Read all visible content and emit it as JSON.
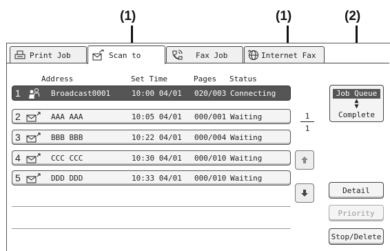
{
  "callouts": [
    "(1)",
    "(1)",
    "(2)"
  ],
  "tabs": [
    {
      "label": "Print Job",
      "icon": "printer-icon"
    },
    {
      "label": "Scan to",
      "icon": "scanner-icon"
    },
    {
      "label": "Fax Job",
      "icon": "phone-icon"
    },
    {
      "label": "Internet Fax",
      "icon": "globe-phone-icon"
    }
  ],
  "columns": {
    "address": "Address",
    "set_time": "Set Time",
    "pages": "Pages",
    "status": "Status"
  },
  "jobs": [
    {
      "num": "1",
      "icon": "broadcast-icon",
      "address": "Broadcast0001",
      "time": "10:00 04/01",
      "pages": "020/003",
      "status": "Connecting",
      "selected": true
    },
    {
      "num": "2",
      "icon": "email-icon",
      "address": "AAA AAA",
      "time": "10:05 04/01",
      "pages": "000/001",
      "status": "Waiting"
    },
    {
      "num": "3",
      "icon": "email-icon",
      "address": "BBB BBB",
      "time": "10:22 04/01",
      "pages": "000/004",
      "status": "Waiting"
    },
    {
      "num": "4",
      "icon": "email-icon",
      "address": "CCC CCC",
      "time": "10:30 04/01",
      "pages": "000/010",
      "status": "Waiting"
    },
    {
      "num": "5",
      "icon": "email-icon",
      "address": "DDD DDD",
      "time": "10:33 04/01",
      "pages": "000/010",
      "status": "Waiting"
    }
  ],
  "toggle": {
    "job_queue": "Job Queue",
    "complete": "Complete"
  },
  "page_indicator": {
    "current": "1",
    "total": "1"
  },
  "buttons": {
    "detail": "Detail",
    "priority": "Priority",
    "stop_delete": "Stop/Delete"
  }
}
